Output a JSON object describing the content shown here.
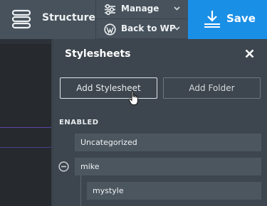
{
  "toolbar": {
    "structure_label": "Structure",
    "manage_label": "Manage",
    "back_label": "Back to WP",
    "save_label": "Save"
  },
  "icons": {
    "structure": "structure-icon",
    "manage": "sliders-icon",
    "wordpress": "wordpress-icon",
    "save": "download-icon",
    "close": "close-icon",
    "collapse": "minus-circle-icon",
    "cursor": "hand-pointer-icon"
  },
  "panel": {
    "title": "Stylesheets",
    "add_stylesheet_label": "Add Stylesheet",
    "add_folder_label": "Add Folder",
    "section_enabled": "ENABLED",
    "items": [
      {
        "label": "Uncategorized"
      },
      {
        "label": "mike"
      },
      {
        "label": "mystyle"
      }
    ]
  },
  "colors": {
    "accent": "#1a8fe6",
    "toolbar_bg": "#47525c",
    "panel_bg": "#3d464e",
    "row_bg": "#4c565f"
  }
}
